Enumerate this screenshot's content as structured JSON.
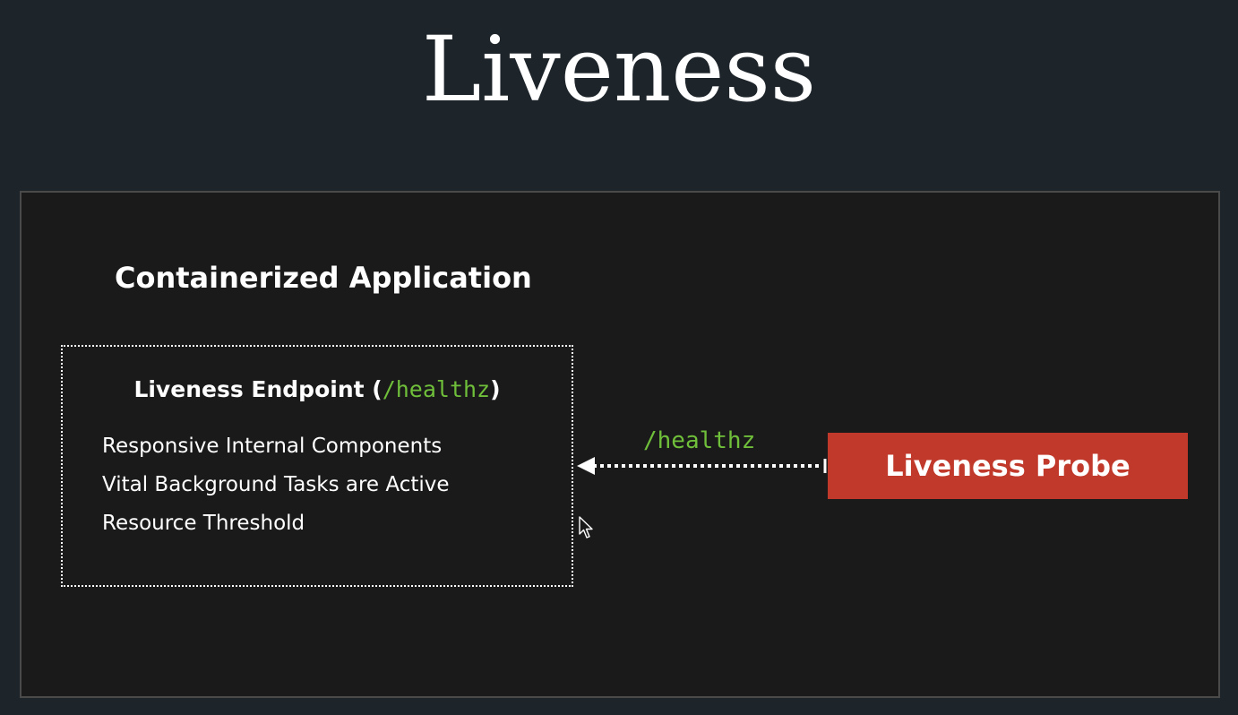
{
  "slide": {
    "title": "Liveness"
  },
  "diagram": {
    "container_label": "Containerized Application",
    "endpoint": {
      "title_prefix": "Liveness Endpoint (",
      "title_path": "/healthz",
      "title_suffix": ")",
      "checks": [
        "Responsive Internal Components",
        "Vital Background Tasks are Active",
        "Resource Threshold"
      ]
    },
    "request_path": "/healthz",
    "probe_label": "Liveness Probe"
  },
  "colors": {
    "background": "#1d252b",
    "panel": "#1a1a1a",
    "accent_green": "#6fbf3a",
    "probe_red": "#c0392b"
  },
  "icons": {
    "arrow": "arrow-left-icon",
    "cursor": "mouse-pointer-icon"
  }
}
